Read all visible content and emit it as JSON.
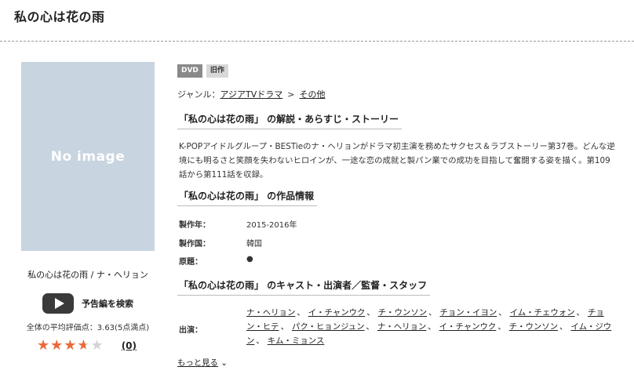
{
  "page": {
    "title": "私の心は花の雨"
  },
  "sidebar": {
    "no_image_text": "No image",
    "caption": "私の心は花の雨 / ナ・ヘリョン",
    "trailer_label": "予告編を検索",
    "average_text": "全体の平均評価点：3.63(5点満点)",
    "rating": 3.63,
    "rating_max": 5,
    "star_glyphs": "★★★★★",
    "review_count": "(0)"
  },
  "badges": {
    "dvd": "DVD",
    "old": "旧作"
  },
  "genre": {
    "label": "ジャンル：",
    "link1": "アジアTVドラマ",
    "separator": ">",
    "link2": "その他"
  },
  "story": {
    "heading": "「私の心は花の雨」 の解説・あらすじ・ストーリー",
    "text": "K-POPアイドルグループ・BESTieのナ・ヘリョンがドラマ初主演を務めたサクセス＆ラブストーリー第37巻。どんな逆境にも明るさと笑顔を失わないヒロインが、一途な恋の成就と製パン業での成功を目指して奮闘する姿を描く。第109話から第111話を収録。"
  },
  "work_info": {
    "heading": "「私の心は花の雨」 の作品情報",
    "rows": [
      {
        "label": "製作年：",
        "value": "2015-2016年"
      },
      {
        "label": "製作国：",
        "value": "韓国"
      },
      {
        "label": "原題：",
        "value": "●"
      }
    ]
  },
  "cast": {
    "heading": "「私の心は花の雨」 のキャスト・出演者／監督・スタッフ",
    "label": "出演：",
    "separator": "、",
    "names": [
      "ナ・ヘリョン",
      "イ・チャンウク",
      "チ・ウンソン",
      "チョン・イヨン",
      "イム・チェウォン",
      "チョン・ヒテ",
      "パク・ヒョンジュン",
      "ナ・ヘリョン",
      "イ・チャンウク",
      "チ・ウンソン",
      "イム・ジウン",
      "キム・ミョンス"
    ],
    "more_label": "もっと見る",
    "more_icon": "⌄"
  },
  "colors": {
    "star": "#ec6a3a",
    "no_image_bg": "#c8d4df"
  }
}
